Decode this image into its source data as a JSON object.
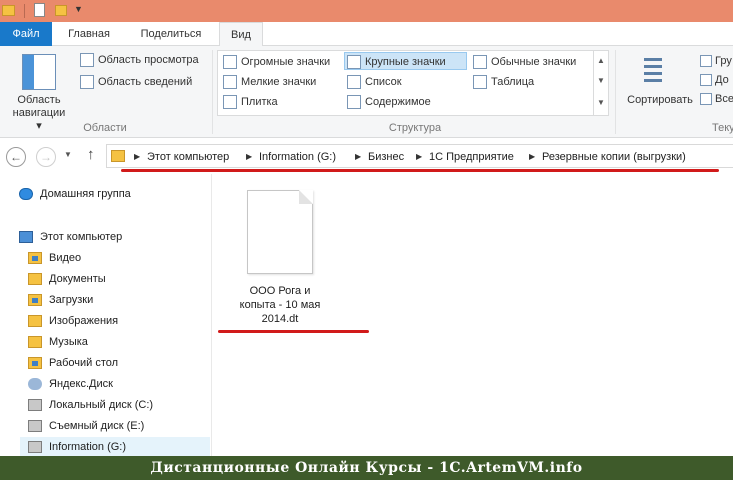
{
  "ribbon_tabs": {
    "file": "Файл",
    "home": "Главная",
    "share": "Поделиться",
    "view": "Вид"
  },
  "panes": {
    "nav_pane_label": "Область навигации",
    "preview": "Область просмотра",
    "details": "Область сведений",
    "group_label": "Области"
  },
  "layout": {
    "items": [
      "Огромные значки",
      "Крупные значки",
      "Обычные значки",
      "Мелкие значки",
      "Список",
      "Таблица",
      "Плитка",
      "Содержимое"
    ],
    "selected": "Крупные значки",
    "group_label": "Структура"
  },
  "sort": {
    "label": "Сортировать",
    "group_label_partial": "Теку"
  },
  "view_cut": {
    "item1": "Гру",
    "item2": "До",
    "item3": "Все"
  },
  "address": {
    "crumbs": [
      "Этот компьютер",
      "Information (G:)",
      "Бизнес",
      "1С Предприятие",
      "Резервные копии (выгрузки)"
    ]
  },
  "sidebar": {
    "homegroup": "Домашняя группа",
    "this_pc": "Этот компьютер",
    "items": [
      "Видео",
      "Документы",
      "Загрузки",
      "Изображения",
      "Музыка",
      "Рабочий стол",
      "Яндекс.Диск",
      "Локальный диск (C:)",
      "Съемный диск (E:)",
      "Information (G:)"
    ]
  },
  "file": {
    "name_line1": "ООО Рога и",
    "name_line2": "копыта - 10 мая",
    "name_line3": "2014.dt"
  },
  "banner": {
    "text": "Дистанционные Онлайн Курсы - 1C.ArtemVM.info"
  },
  "colors": {
    "titlebar": "#e98a6c",
    "file_tab": "#1979ca",
    "selection": "#cce4f7",
    "annotation_red": "#d11a1a",
    "banner_bg": "#3e5a2a"
  }
}
